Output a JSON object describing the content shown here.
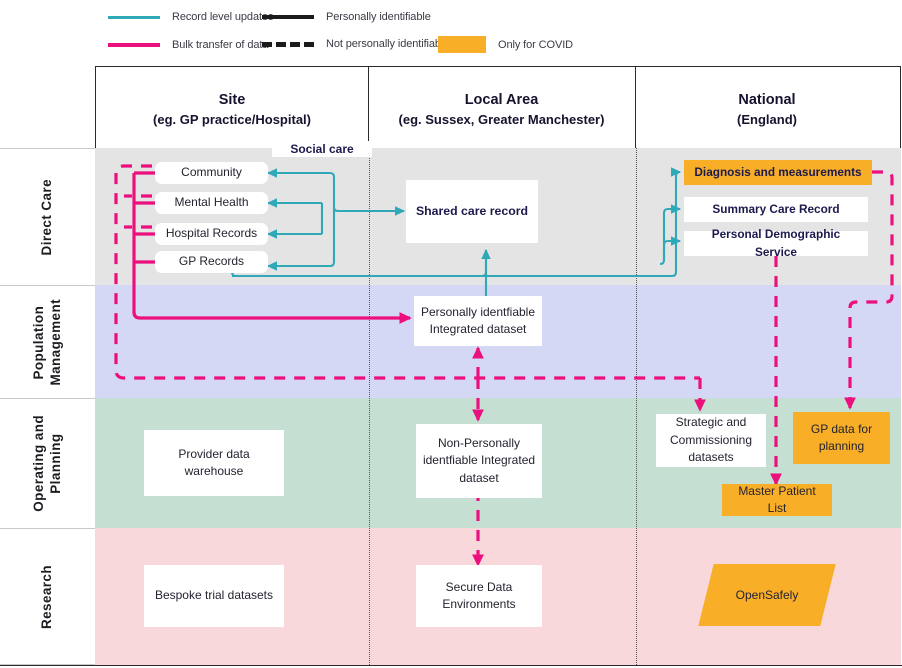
{
  "legend": {
    "items": [
      {
        "id": "record-level-updates",
        "label": "Record level updates",
        "style": "solid-teal",
        "color": "#2FA8B8"
      },
      {
        "id": "bulk-transfer",
        "label": "Bulk transfer of data",
        "style": "solid-pink",
        "color": "#EC0F7E"
      },
      {
        "id": "personally-identifiable",
        "label": "Personally identifiable",
        "style": "solid-black",
        "color": "#1b1b1b"
      },
      {
        "id": "not-personally-identifiable",
        "label": "Not personally identifiable",
        "style": "dashed-black",
        "color": "#1b1b1b"
      },
      {
        "id": "only-for-covid",
        "label": "Only for COVID",
        "style": "swatch",
        "color": "#F8AE26"
      }
    ]
  },
  "columns": [
    {
      "id": "site",
      "title": "Site",
      "subtitle": "(eg. GP practice/Hospital)"
    },
    {
      "id": "local-area",
      "title": "Local Area",
      "subtitle": "(eg. Sussex, Greater Manchester)"
    },
    {
      "id": "national",
      "title": "National",
      "subtitle": "(England)"
    }
  ],
  "rows": [
    {
      "id": "direct-care",
      "label": "Direct Care",
      "band_color": "#E4E4E4"
    },
    {
      "id": "population-management",
      "label": "Population\nManagement",
      "band_color": "#D5D8F4"
    },
    {
      "id": "operating-and-planning",
      "label": "Operating and\nPlanning",
      "band_color": "#C5DFD3"
    },
    {
      "id": "research",
      "label": "Research",
      "band_color": "#F8D8DB"
    }
  ],
  "annotations": {
    "social_care": "Social care"
  },
  "nodes": {
    "community": "Community",
    "mental_health": "Mental Health",
    "hospital_records": "Hospital Records",
    "gp_records": "GP Records",
    "shared_care_record": "Shared care record",
    "diagnosis_and_measurements": "Diagnosis and measurements",
    "summary_care_record": "Summary Care Record",
    "personal_demographic_service": "Personal Demographic Service",
    "pi_integrated_dataset_line1": "Personally identfiable",
    "pi_integrated_dataset_line2": "Integrated dataset",
    "provider_data_warehouse_line1": "Provider data",
    "provider_data_warehouse_line2": "warehouse",
    "npi_integrated_dataset_line1": "Non-Personally",
    "npi_integrated_dataset_line2": "identfiable Integrated",
    "npi_integrated_dataset_line3": "dataset",
    "strategic_commissioning_line1": "Strategic and",
    "strategic_commissioning_line2": "Commissioning",
    "strategic_commissioning_line3": "datasets",
    "gp_data_for_planning_line1": "GP data for",
    "gp_data_for_planning_line2": "planning",
    "master_patient_list": "Master Patient List",
    "bespoke_trial_datasets": "Bespoke trial datasets",
    "secure_data_environments_line1": "Secure Data",
    "secure_data_environments_line2": "Environments",
    "opensafely": "OpenSafely"
  },
  "palette": {
    "teal": "#2FA8B8",
    "pink": "#EC0F7E",
    "orange": "#F8AE26",
    "navy_text": "#1c1a4d"
  }
}
